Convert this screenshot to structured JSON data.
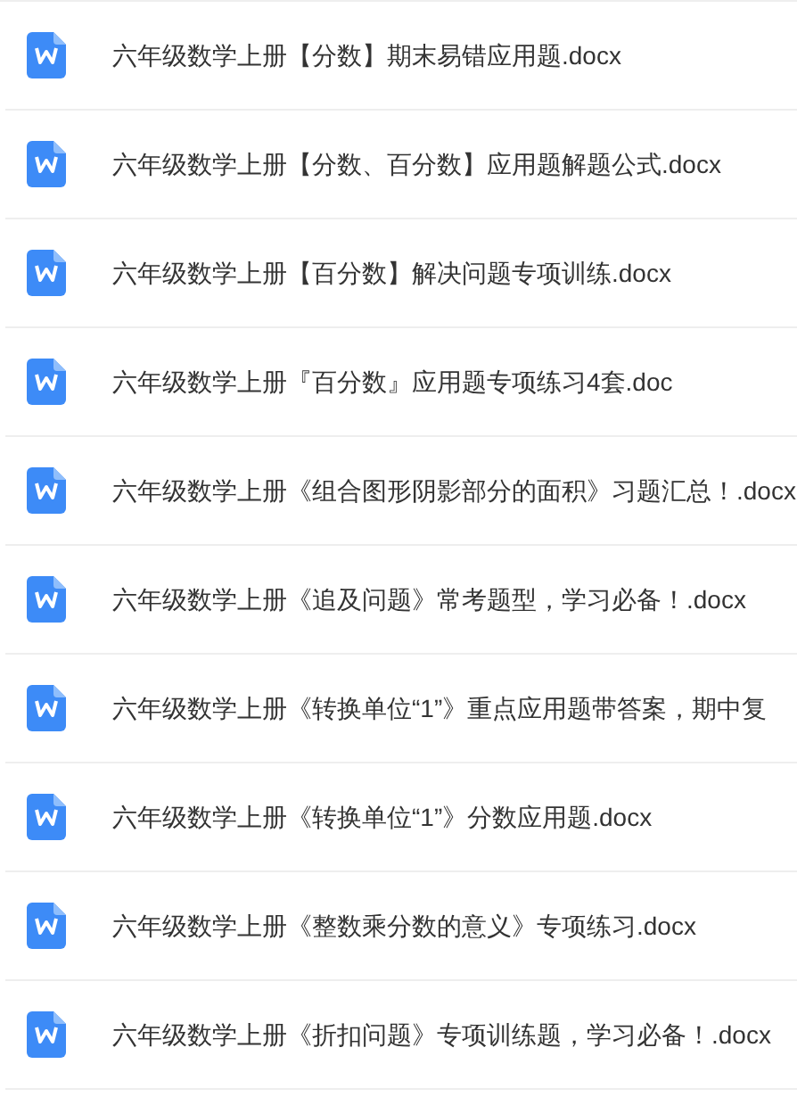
{
  "files": [
    {
      "name": "六年级数学上册【分数】期末易错应用题.docx",
      "kind": "word"
    },
    {
      "name": "六年级数学上册【分数、百分数】应用题解题公式.docx",
      "kind": "word"
    },
    {
      "name": "六年级数学上册【百分数】解决问题专项训练.docx",
      "kind": "word"
    },
    {
      "name": "六年级数学上册『百分数』应用题专项练习4套.doc",
      "kind": "word"
    },
    {
      "name": "六年级数学上册《组合图形阴影部分的面积》习题汇总！.docx",
      "kind": "word"
    },
    {
      "name": "六年级数学上册《追及问题》常考题型，学习必备！.docx",
      "kind": "word"
    },
    {
      "name": "六年级数学上册《转换单位“1”》重点应用题带答案，期中复",
      "kind": "word"
    },
    {
      "name": "六年级数学上册《转换单位“1”》分数应用题.docx",
      "kind": "word"
    },
    {
      "name": "六年级数学上册《整数乘分数的意义》专项练习.docx",
      "kind": "word"
    },
    {
      "name": "六年级数学上册《折扣问题》专项训练题，学习必备！.docx",
      "kind": "word"
    }
  ]
}
